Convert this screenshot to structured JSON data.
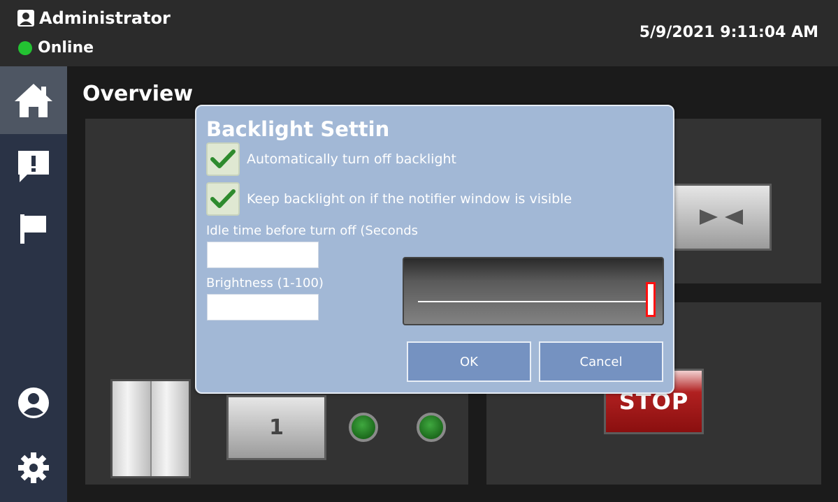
{
  "header": {
    "user_name": "Administrator",
    "status_text": "Online",
    "status_color": "#23c232",
    "datetime": "5/9/2021 9:11:04 AM"
  },
  "sidebar": {
    "items": [
      {
        "icon": "home-icon",
        "active": true
      },
      {
        "icon": "alert-message-icon",
        "active": false
      },
      {
        "icon": "flag-icon",
        "active": false
      },
      {
        "icon": "user-profile-icon",
        "active": false
      },
      {
        "icon": "gear-icon",
        "active": false
      }
    ]
  },
  "main": {
    "title": "Overview",
    "floor_button_label": "1",
    "stop_label": "STOP"
  },
  "dialog": {
    "title": "Backlight Settin",
    "auto_off_label": "Automatically turn off backlight",
    "auto_off_checked": true,
    "keep_on_label": "Keep backlight on if the notifier window is visible",
    "keep_on_checked": true,
    "idle_label": "Idle time before turn off (Seconds",
    "idle_value": "",
    "brightness_label": "Brightness (1-100)",
    "brightness_value": "",
    "slider_value_fraction": 1.0,
    "ok_label": "OK",
    "cancel_label": "Cancel"
  },
  "colors": {
    "dialog_bg": "#a2b8d6",
    "button_bg": "#7592c1",
    "sidebar_bg": "#2a3346",
    "slider_thumb": "#ff1010",
    "stop_red": "#b02020"
  }
}
